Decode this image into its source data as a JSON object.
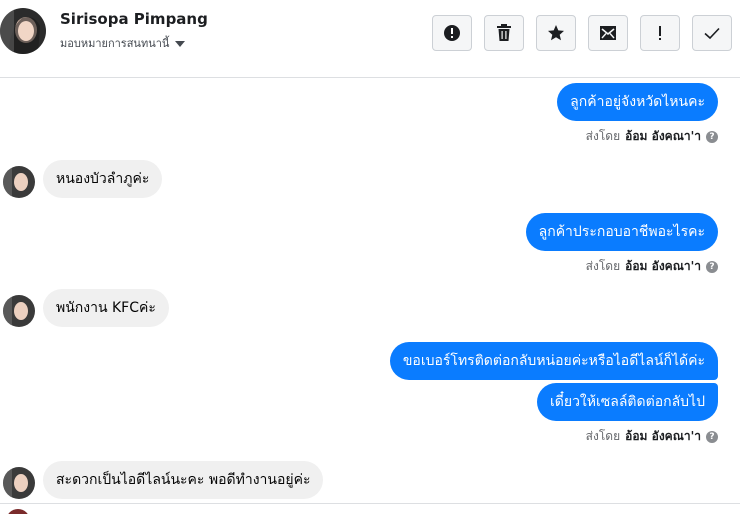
{
  "header": {
    "contact_name": "Sirisopa Pimpang",
    "assign_label": "มอบหมายการสนทนานี้"
  },
  "toolbar": [
    {
      "icon": "alert-circle-icon"
    },
    {
      "icon": "trash-icon"
    },
    {
      "icon": "star-icon"
    },
    {
      "icon": "mark-unread-icon"
    },
    {
      "icon": "exclamation-icon"
    },
    {
      "icon": "checkmark-icon"
    }
  ],
  "messages": {
    "m1": "ลูกค้าอยู่จังหวัดไหนคะ",
    "m2": "หนองบัวลำภูค่ะ",
    "m3": "ลูกค้าประกอบอาชีพอะไรคะ",
    "m4": "พนักงาน KFCค่ะ",
    "m5": "ขอเบอร์โทรติดต่อกลับหน่อยค่ะหรือไอดีไลน์ก็ได้ค่ะ",
    "m6": "เดี๋ยวให้เซลล์ติดต่อกลับไป",
    "m7": "สะดวกเป็นไอดีไลน์นะคะ พอดีทำงานอยู่ค่ะ"
  },
  "sent_by": {
    "prefix": "ส่งโดย",
    "agent": "อ้อม อังคณา'า",
    "help": "?"
  },
  "colors": {
    "outgoing_bubble": "#0a7cff",
    "incoming_bubble": "#f0f0f0"
  }
}
